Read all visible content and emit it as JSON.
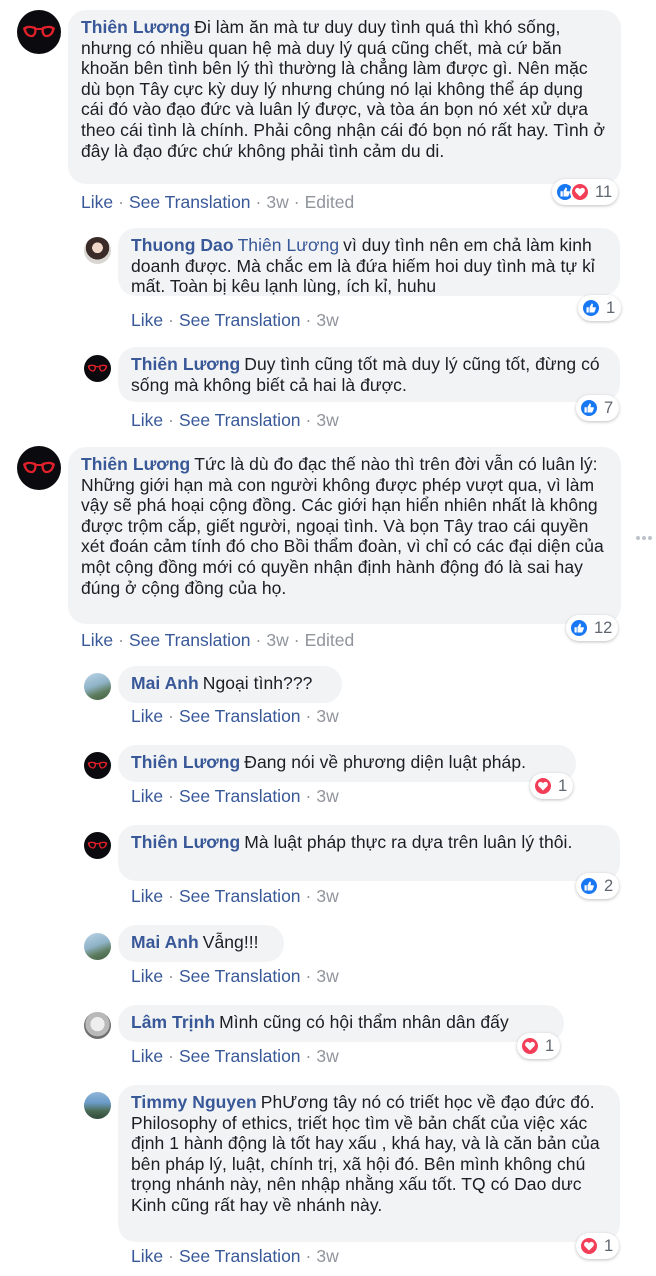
{
  "actions": {
    "like": "Like",
    "translate": "See Translation",
    "sep": "·"
  },
  "colors": {
    "name": "#385898",
    "bubble": "#f2f3f5",
    "like": "#1877f2",
    "love": "#f33e58"
  },
  "comments": [
    {
      "author": "Thiên Lương",
      "text": "Đi làm ăn mà tư duy duy tình quá thì khó sống, nhưng có nhiều quan hệ mà duy lý quá cũng chết, mà cứ băn khoăn bên tình bên lý thì thường là chẳng làm được gì. Nên mặc dù bọn Tây cực kỳ duy lý nhưng chúng nó lại không thể áp dụng cái đó vào đạo đức và luân lý được, và tòa án bọn nó xét xử dựa theo cái tình là chính. Phải công nhận cái đó bọn nó rất hay. Tình ở đây là đạo đức chứ không phải tình cảm du di.",
      "time": "3w",
      "edited": "Edited",
      "reactions": [
        "like-icon",
        "love-icon"
      ],
      "count": "11",
      "replies": [
        {
          "author": "Thuong Dao",
          "mention": "Thiên Lương",
          "text": "vì duy tình nên em chả làm kinh doanh được. Mà chắc em là đứa hiếm hoi duy tình mà tự kỉ mất. Toàn bị kêu lạnh lùng, ích kỉ, huhu",
          "time": "3w",
          "reactions": [
            "like-icon"
          ],
          "count": "1"
        },
        {
          "author": "Thiên Lương",
          "text": "Duy tình cũng tốt mà duy lý cũng tốt, đừng có sống mà không biết cả hai là được.",
          "time": "3w",
          "reactions": [
            "like-icon"
          ],
          "count": "7"
        }
      ]
    },
    {
      "author": "Thiên Lương",
      "text": "Tức là dù đo đạc thế nào thì trên đời vẫn có luân lý: Những giới hạn mà con người không được phép vượt qua, vì làm vậy sẽ phá hoại cộng đồng. Các giới hạn hiển nhiên nhất là không được trộm cắp, giết người, ngoại tình. Và bọn Tây trao cái quyền xét đoán cảm tính đó cho Bồi thẩm đoàn, vì chỉ có các đại diện của một cộng đồng mới có quyền nhận định hành động đó là sai hay đúng ở cộng đồng của họ.",
      "time": "3w",
      "edited": "Edited",
      "reactions": [
        "like-icon"
      ],
      "count": "12",
      "replies": [
        {
          "author": "Mai Anh",
          "text": "Ngoại tình???",
          "time": "3w"
        },
        {
          "author": "Thiên Lương",
          "text": "Đang nói về phương diện luật pháp.",
          "time": "3w",
          "reactions": [
            "love-icon"
          ],
          "count": "1"
        },
        {
          "author": "Thiên Lương",
          "text": "Mà luật pháp thực ra dựa trên luân lý thôi.",
          "time": "3w",
          "reactions": [
            "like-icon"
          ],
          "count": "2"
        },
        {
          "author": "Mai Anh",
          "text": "Vẫng!!!",
          "time": "3w"
        },
        {
          "author": "Lâm Trịnh",
          "text": "Mình cũng có hội thẩm nhân dân đấy",
          "time": "3w",
          "reactions": [
            "love-icon"
          ],
          "count": "1"
        },
        {
          "author": "Timmy Nguyen",
          "text": "PhƯơng tây nó có triết học về đạo đức đó. Philosophy of ethics, triết học tìm về bản chất của việc xác định 1 hành động là tốt hay xấu , khá hay, và là căn bản của bên pháp lý, luật, chính trị, xã hội đó. Bên mình không chú trọng nhánh này, nên nhập nhằng xấu tốt. TQ có Dao dưc Kinh cũng rất hay về nhánh này.",
          "time": "3w",
          "reactions": [
            "love-icon"
          ],
          "count": "1"
        }
      ]
    }
  ]
}
